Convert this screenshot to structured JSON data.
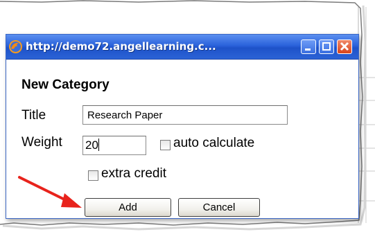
{
  "window": {
    "title": "http://demo72.angellearning.c...",
    "icon": "firefox-icon",
    "controls": [
      "minimize-icon",
      "maximize-icon",
      "close-icon"
    ]
  },
  "form": {
    "heading": "New Category",
    "title_label": "Title",
    "title_value": "Research Paper",
    "weight_label": "Weight",
    "weight_value": "20",
    "auto_calculate_label": "auto calculate",
    "auto_calculate_checked": false,
    "extra_credit_label": "extra credit",
    "extra_credit_checked": false,
    "add_label": "Add",
    "cancel_label": "Cancel"
  },
  "annotation": {
    "arrow_color": "#e8231c",
    "points_to": "add-button"
  },
  "colors": {
    "titlebar": "#2a62db",
    "close_button": "#d9441b"
  }
}
